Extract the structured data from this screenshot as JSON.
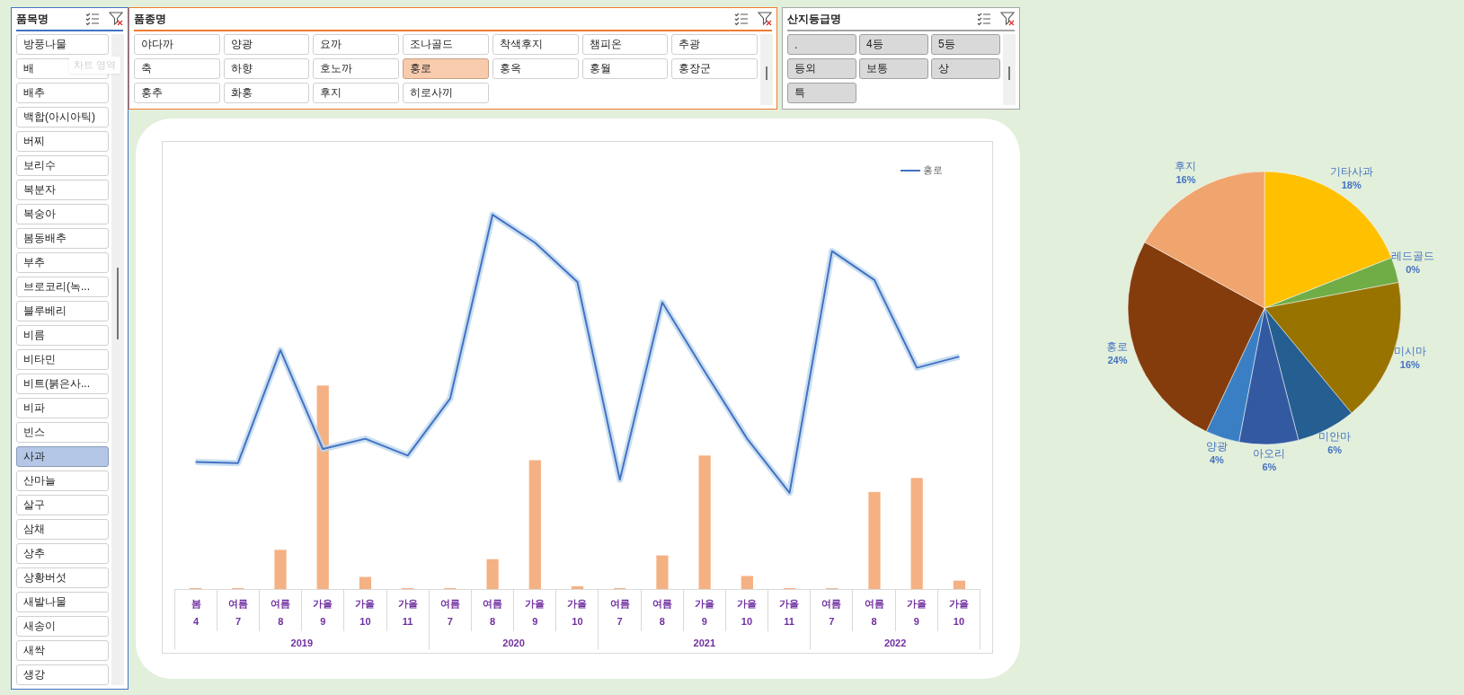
{
  "tooltip": "차트 영역",
  "item_slicer": {
    "title": "품목명",
    "items": [
      {
        "label": "방풍나물",
        "selected": false
      },
      {
        "label": "배",
        "selected": false
      },
      {
        "label": "배추",
        "selected": false
      },
      {
        "label": "백합(아시아틱)",
        "selected": false
      },
      {
        "label": "버찌",
        "selected": false
      },
      {
        "label": "보리수",
        "selected": false
      },
      {
        "label": "복분자",
        "selected": false
      },
      {
        "label": "복숭아",
        "selected": false
      },
      {
        "label": "봄동배추",
        "selected": false
      },
      {
        "label": "부추",
        "selected": false
      },
      {
        "label": "브로코리(녹...",
        "selected": false
      },
      {
        "label": "블루베리",
        "selected": false
      },
      {
        "label": "비름",
        "selected": false
      },
      {
        "label": "비타민",
        "selected": false
      },
      {
        "label": "비트(붉은사...",
        "selected": false
      },
      {
        "label": "비파",
        "selected": false
      },
      {
        "label": "빈스",
        "selected": false
      },
      {
        "label": "사과",
        "selected": true
      },
      {
        "label": "산마늘",
        "selected": false
      },
      {
        "label": "살구",
        "selected": false
      },
      {
        "label": "삼채",
        "selected": false
      },
      {
        "label": "상추",
        "selected": false
      },
      {
        "label": "상황버섯",
        "selected": false
      },
      {
        "label": "새발나물",
        "selected": false
      },
      {
        "label": "새송이",
        "selected": false
      },
      {
        "label": "새싹",
        "selected": false
      },
      {
        "label": "생강",
        "selected": false
      }
    ]
  },
  "variety_slicer": {
    "title": "품종명",
    "items": [
      {
        "label": "야다까",
        "selected": false
      },
      {
        "label": "양광",
        "selected": false
      },
      {
        "label": "요까",
        "selected": false
      },
      {
        "label": "조나골드",
        "selected": false
      },
      {
        "label": "착색후지",
        "selected": false
      },
      {
        "label": "챔피온",
        "selected": false
      },
      {
        "label": "추광",
        "selected": false
      },
      {
        "label": "축",
        "selected": false
      },
      {
        "label": "하향",
        "selected": false
      },
      {
        "label": "호노까",
        "selected": false
      },
      {
        "label": "홍로",
        "selected": true
      },
      {
        "label": "홍옥",
        "selected": false
      },
      {
        "label": "홍월",
        "selected": false
      },
      {
        "label": "홍장군",
        "selected": false
      },
      {
        "label": "홍추",
        "selected": false
      },
      {
        "label": "화홍",
        "selected": false
      },
      {
        "label": "후지",
        "selected": false
      },
      {
        "label": "히로사끼",
        "selected": false
      }
    ]
  },
  "grade_slicer": {
    "title": "산지등급명",
    "items": [
      {
        "label": ".",
        "selected": true
      },
      {
        "label": "4등",
        "selected": true
      },
      {
        "label": "5등",
        "selected": true
      },
      {
        "label": "등외",
        "selected": true
      },
      {
        "label": "보통",
        "selected": true
      },
      {
        "label": "상",
        "selected": true
      },
      {
        "label": "특",
        "selected": true
      }
    ]
  },
  "line_chart": {
    "legend": "홍로",
    "years": [
      {
        "label": "2019",
        "points": [
          {
            "season": "봄",
            "month": "4"
          },
          {
            "season": "여름",
            "month": "7"
          },
          {
            "season": "여름",
            "month": "8"
          },
          {
            "season": "가을",
            "month": "9"
          },
          {
            "season": "가을",
            "month": "10"
          },
          {
            "season": "가을",
            "month": "11"
          }
        ]
      },
      {
        "label": "2020",
        "points": [
          {
            "season": "여름",
            "month": "7"
          },
          {
            "season": "여름",
            "month": "8"
          },
          {
            "season": "가을",
            "month": "9"
          },
          {
            "season": "가을",
            "month": "10"
          }
        ]
      },
      {
        "label": "2021",
        "points": [
          {
            "season": "여름",
            "month": "7"
          },
          {
            "season": "여름",
            "month": "8"
          },
          {
            "season": "가을",
            "month": "9"
          },
          {
            "season": "가을",
            "month": "10"
          },
          {
            "season": "가을",
            "month": "11"
          }
        ]
      },
      {
        "label": "2022",
        "points": [
          {
            "season": "여름",
            "month": "7"
          },
          {
            "season": "여름",
            "month": "8"
          },
          {
            "season": "가을",
            "month": "9"
          },
          {
            "season": "가을",
            "month": "10"
          }
        ]
      }
    ]
  },
  "pie": {
    "chart_data": {
      "type": "pie",
      "categories": [
        "기타사과",
        "레드골드",
        "미시마",
        "미안마",
        "아오리",
        "양광",
        "홍로",
        "후지"
      ],
      "series": [
        {
          "values": [
            19,
            3,
            17,
            7,
            7,
            4,
            26,
            17
          ]
        }
      ],
      "colors": [
        "#ffc000",
        "#70ad47",
        "#997300",
        "#255e91",
        "#335aa1",
        "#3a7fc4",
        "#843c0c",
        "#f0a46e"
      ],
      "value_labels": [
        "18%",
        "0%",
        "16%",
        "6%",
        "6%",
        "4%",
        "24%",
        "16%"
      ]
    }
  }
}
